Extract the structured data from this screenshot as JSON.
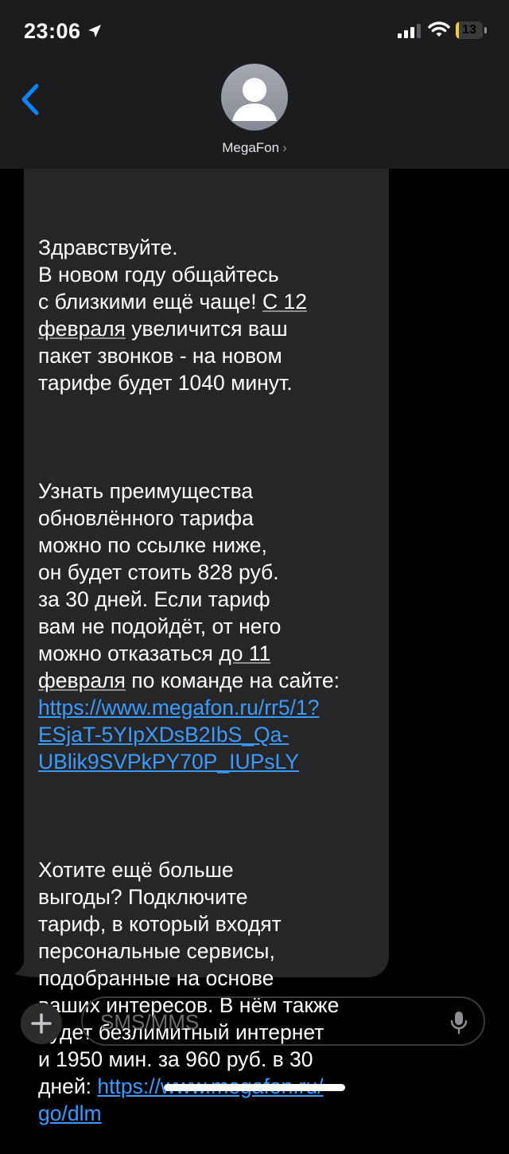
{
  "status": {
    "time": "23:06",
    "battery": "13",
    "battery_level": 0.13
  },
  "header": {
    "contact_name": "MegaFon",
    "chevron": "›"
  },
  "message": {
    "p1": [
      "Здравствуйте.\nВ новом году общайтесь\nс близкими ещё чаще! ",
      "С 12\nфевраля",
      " увеличится ваш\nпакет звонков - на новом\nтарифе будет 1040 минут."
    ],
    "p2": [
      "Узнать преимущества\nобновлённого тарифа\nможно по ссылке ниже,\nон будет стоить 828 руб.\nза 30 дней. Если тариф\nвам не подойдёт, от него\nможно отказаться ",
      "до 11\nфевраля",
      " по команде на сайте:\n",
      "https://www.megafon.ru/rr5/1?\nESjaT-5YIpXDsB2IbS_Qa-\nUBlik9SVPkPY70P_IUPsLY"
    ],
    "p3": [
      "Хотите ещё больше\nвыгоды? Подключите\nтариф, в который входят\nперсональные сервисы,\nподобранные на основе\nваших интересов. В нём также\nбудет безлимитный интернет\nи 1950 мин. за 960 руб. в 30\nдней: ",
      "https://www.megafon.ru/\ngo/dlm"
    ]
  },
  "compose": {
    "placeholder": "SMS/MMS"
  },
  "colors": {
    "link": "#3b9bff",
    "bubble": "#262628",
    "header": "#1c1c1e",
    "battery": "#f5cc2b"
  },
  "icons": [
    "location-arrow-icon",
    "cellular-signal-icon",
    "wifi-icon",
    "battery-icon",
    "back-chevron-icon",
    "contact-person-icon",
    "plus-icon",
    "microphone-icon"
  ]
}
